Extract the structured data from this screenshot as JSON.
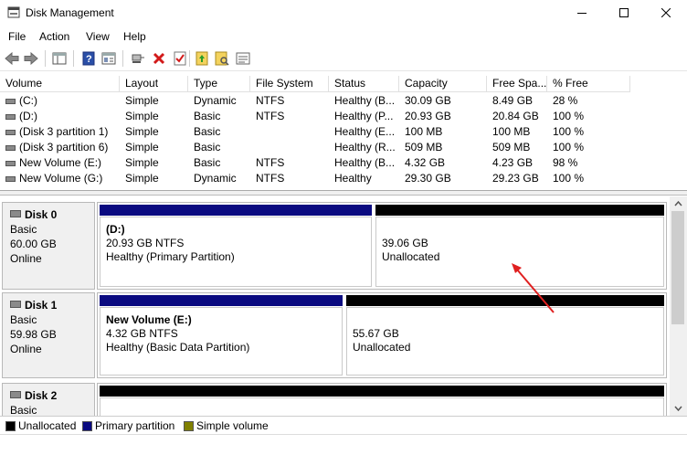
{
  "window": {
    "title": "Disk Management"
  },
  "menu": [
    "File",
    "Action",
    "View",
    "Help"
  ],
  "toolbar": {
    "icons": [
      "back-icon",
      "forward-icon",
      "console-tree-icon",
      "help-icon",
      "properties-icon",
      "connect-icon",
      "delete-icon",
      "check-icon",
      "folder-up-icon",
      "open-folder-icon",
      "list-icon"
    ]
  },
  "volumes": {
    "columns": [
      "Volume",
      "Layout",
      "Type",
      "File System",
      "Status",
      "Capacity",
      "Free Spa...",
      "% Free"
    ],
    "rows": [
      [
        "(C:)",
        "Simple",
        "Dynamic",
        "NTFS",
        "Healthy (B...",
        "30.09 GB",
        "8.49 GB",
        "28 %"
      ],
      [
        "(D:)",
        "Simple",
        "Basic",
        "NTFS",
        "Healthy (P...",
        "20.93 GB",
        "20.84 GB",
        "100 %"
      ],
      [
        "(Disk 3 partition 1)",
        "Simple",
        "Basic",
        "",
        "Healthy (E...",
        "100 MB",
        "100 MB",
        "100 %"
      ],
      [
        "(Disk 3 partition 6)",
        "Simple",
        "Basic",
        "",
        "Healthy (R...",
        "509 MB",
        "509 MB",
        "100 %"
      ],
      [
        "New Volume (E:)",
        "Simple",
        "Basic",
        "NTFS",
        "Healthy (B...",
        "4.32 GB",
        "4.23 GB",
        "98 %"
      ],
      [
        "New Volume (G:)",
        "Simple",
        "Dynamic",
        "NTFS",
        "Healthy",
        "29.30 GB",
        "29.23 GB",
        "100 %"
      ]
    ]
  },
  "disks": [
    {
      "name": "Disk 0",
      "type": "Basic",
      "size": "60.00 GB",
      "state": "Online",
      "partitions": [
        {
          "name": "(D:)",
          "size": "20.93 GB NTFS",
          "status": "Healthy (Primary Partition)",
          "kind": "primary"
        },
        {
          "name": "",
          "size": "39.06 GB",
          "status": "Unallocated",
          "kind": "unallocated"
        }
      ]
    },
    {
      "name": "Disk 1",
      "type": "Basic",
      "size": "59.98 GB",
      "state": "Online",
      "partitions": [
        {
          "name": "New Volume  (E:)",
          "size": "4.32 GB NTFS",
          "status": "Healthy (Basic Data Partition)",
          "kind": "primary"
        },
        {
          "name": "",
          "size": "55.67 GB",
          "status": "Unallocated",
          "kind": "unallocated"
        }
      ]
    },
    {
      "name": "Disk 2",
      "type": "Basic",
      "size": "",
      "state": "",
      "partitions": []
    }
  ],
  "legend": [
    {
      "label": "Unallocated",
      "color": "#000000"
    },
    {
      "label": "Primary partition",
      "color": "#0a0a80"
    },
    {
      "label": "Simple volume",
      "color": "#808000"
    }
  ],
  "colors": {
    "primary": "#0a0a80",
    "unallocated": "#000000",
    "annotation": "#e02020"
  }
}
